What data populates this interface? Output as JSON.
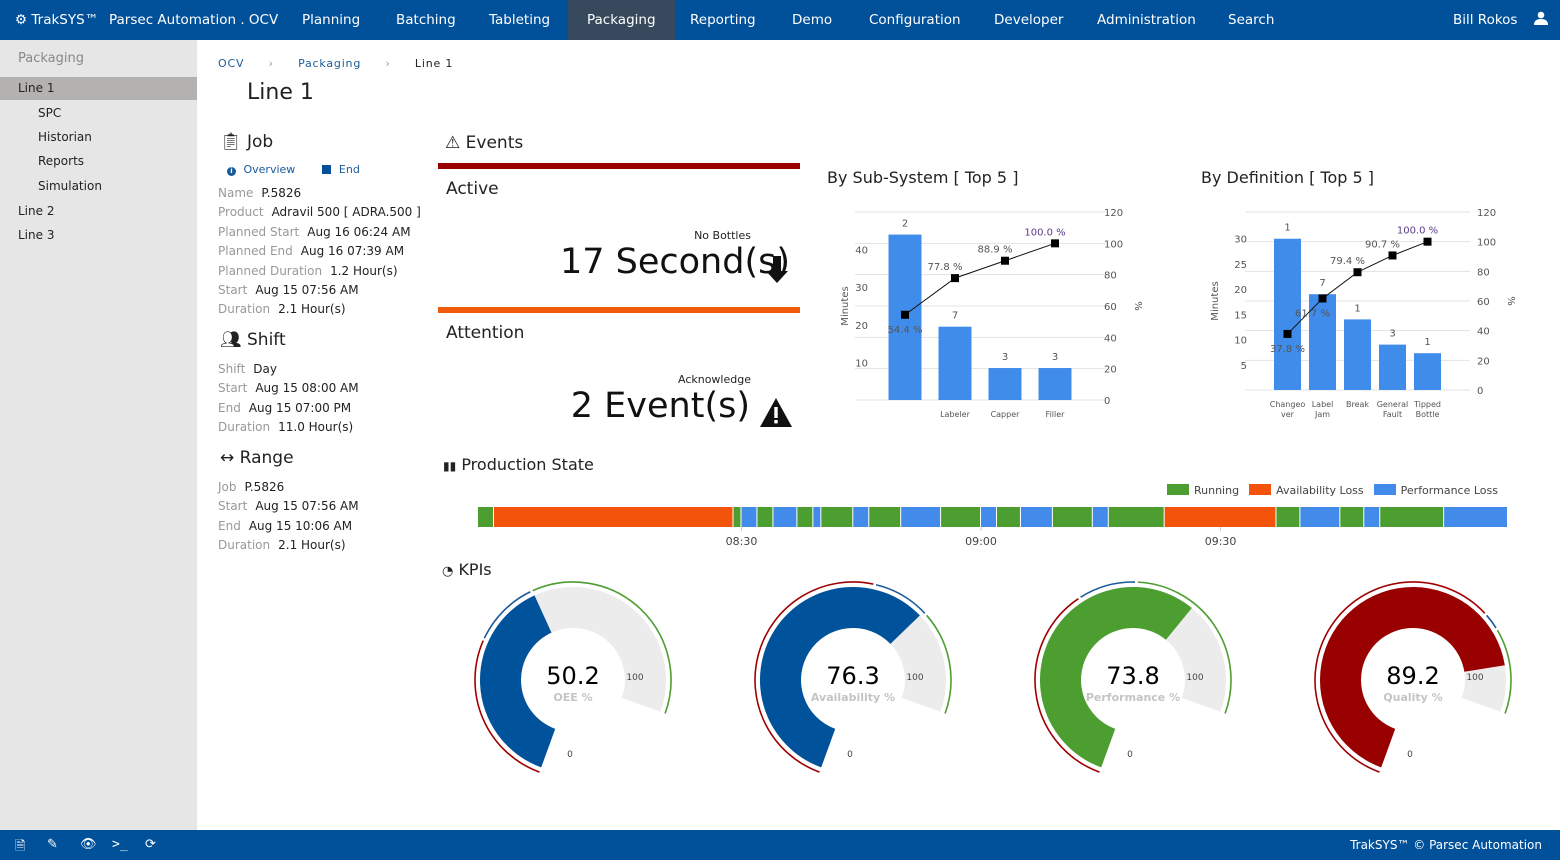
{
  "nav": {
    "brand": "TrakSYS™",
    "site": "Parsec Automation . OCV",
    "items": [
      "Planning",
      "Batching",
      "Tableting",
      "Packaging",
      "Reporting",
      "Demo",
      "Configuration",
      "Developer",
      "Administration",
      "Search"
    ],
    "active": "Packaging",
    "user": "Bill Rokos"
  },
  "sidebar": {
    "header": "Packaging",
    "items": [
      {
        "label": "Line 1",
        "selected": true
      },
      {
        "label": "SPC"
      },
      {
        "label": "Historian"
      },
      {
        "label": "Reports"
      },
      {
        "label": "Simulation"
      },
      {
        "label": "Line 2"
      },
      {
        "label": "Line 3"
      }
    ]
  },
  "breadcrumb": [
    "OCV",
    "Packaging",
    "Line 1"
  ],
  "page_title": "Line 1",
  "job": {
    "title": "Job",
    "overview": "Overview",
    "end": "End",
    "fields": [
      [
        "Name",
        "P.5826"
      ],
      [
        "Product",
        "Adravil 500 [ ADRA.500 ]"
      ],
      [
        "Planned Start",
        "Aug 16 06:24 AM"
      ],
      [
        "Planned End",
        "Aug 16 07:39 AM"
      ],
      [
        "Planned Duration",
        "1.2 Hour(s)"
      ],
      [
        "Start",
        "Aug 15 07:56 AM"
      ],
      [
        "Duration",
        "2.1 Hour(s)"
      ]
    ]
  },
  "shift": {
    "title": "Shift",
    "fields": [
      [
        "Shift",
        "Day"
      ],
      [
        "Start",
        "Aug 15 08:00 AM"
      ],
      [
        "End",
        "Aug 15 07:00 PM"
      ],
      [
        "Duration",
        "11.0 Hour(s)"
      ]
    ]
  },
  "range": {
    "title": "Range",
    "fields": [
      [
        "Job",
        "P.5826"
      ],
      [
        "Start",
        "Aug 15 07:56 AM"
      ],
      [
        "End",
        "Aug 15 10:06 AM"
      ],
      [
        "Duration",
        "2.1 Hour(s)"
      ]
    ]
  },
  "events": {
    "title": "Events",
    "active": {
      "label": "Active",
      "caption": "No Bottles",
      "value": "17 Second(s)",
      "color": "#9b0000"
    },
    "attention": {
      "label": "Attention",
      "caption": "Acknowledge",
      "value": "2 Event(s)",
      "color": "#f05a0a"
    }
  },
  "chart_data": [
    {
      "type": "bar",
      "title": "By Sub-System [ Top 5 ]",
      "ylabel": "Minutes",
      "y2label": "%",
      "yticks": [
        10,
        20,
        30,
        40
      ],
      "y2ticks": [
        0,
        20,
        40,
        60,
        80,
        100,
        120
      ],
      "ylim": [
        0,
        50
      ],
      "y2lim": [
        0,
        120
      ],
      "categories": [
        "",
        "Labeler",
        "Capper",
        "Filler"
      ],
      "values": [
        44,
        19.5,
        8.5,
        8.5
      ],
      "bar_labels": [
        "2",
        "7",
        "3",
        "3"
      ],
      "cumulative": [
        54.4,
        77.8,
        88.9,
        100.0
      ],
      "cumulative_labels": [
        "54.4 %",
        "77.8 %",
        "88.9 %",
        "100.0 %"
      ],
      "color": "#3f8ceb"
    },
    {
      "type": "bar",
      "title": "By Definition [ Top 5 ]",
      "ylabel": "Minutes",
      "y2label": "%",
      "yticks": [
        5,
        10,
        15,
        20,
        25,
        30
      ],
      "y2ticks": [
        0,
        20,
        40,
        60,
        80,
        100,
        120
      ],
      "ylim": [
        0,
        35.3
      ],
      "y2lim": [
        0,
        120
      ],
      "categories": [
        [
          "Changeo",
          "ver"
        ],
        [
          "Label",
          "Jam"
        ],
        [
          "Break"
        ],
        [
          "General",
          "Fault"
        ],
        [
          "Tipped",
          "Bottle"
        ]
      ],
      "values": [
        30,
        19,
        14,
        9,
        7.3
      ],
      "bar_labels": [
        "1",
        "7",
        "1",
        "3",
        "1"
      ],
      "cumulative": [
        37.8,
        61.7,
        79.4,
        90.7,
        100.0
      ],
      "cumulative_labels": [
        "37.8 %",
        "61.7 %",
        "79.4 %",
        "90.7 %",
        "100.0 %"
      ],
      "color": "#3f8ceb"
    }
  ],
  "production": {
    "title": "Production State",
    "legend": [
      {
        "name": "Running",
        "color": "#4c9e30"
      },
      {
        "name": "Availability Loss",
        "color": "#f3530a"
      },
      {
        "name": "Performance Loss",
        "color": "#428bea"
      }
    ],
    "start": "07:57",
    "end": "10:06",
    "ticks": [
      "08:30",
      "09:00",
      "09:30"
    ],
    "segments": [
      [
        "07:57",
        "Running"
      ],
      [
        "07:59",
        "Availability Loss"
      ],
      [
        "08:29",
        "Running"
      ],
      [
        "08:30",
        "Performance Loss"
      ],
      [
        "08:32",
        "Running"
      ],
      [
        "08:34",
        "Performance Loss"
      ],
      [
        "08:37",
        "Running"
      ],
      [
        "08:39",
        "Performance Loss"
      ],
      [
        "08:40",
        "Running"
      ],
      [
        "08:44",
        "Performance Loss"
      ],
      [
        "08:46",
        "Running"
      ],
      [
        "08:50",
        "Performance Loss"
      ],
      [
        "08:55",
        "Running"
      ],
      [
        "09:00",
        "Performance Loss"
      ],
      [
        "09:02",
        "Running"
      ],
      [
        "09:05",
        "Performance Loss"
      ],
      [
        "09:09",
        "Running"
      ],
      [
        "09:14",
        "Performance Loss"
      ],
      [
        "09:16",
        "Running"
      ],
      [
        "09:23",
        "Availability Loss"
      ],
      [
        "09:37",
        "Running"
      ],
      [
        "09:40",
        "Performance Loss"
      ],
      [
        "09:45",
        "Running"
      ],
      [
        "09:48",
        "Performance Loss"
      ],
      [
        "09:50",
        "Running"
      ],
      [
        "09:58",
        "Performance Loss"
      ]
    ]
  },
  "kpis": {
    "title": "KPIs",
    "min": "0",
    "max": "100",
    "gauges": [
      {
        "value": 50.2,
        "text": "50.2",
        "label": "OEE %",
        "color": "#00529b",
        "bands": [
          35,
          50
        ]
      },
      {
        "value": 76.3,
        "text": "76.3",
        "label": "Availability %",
        "color": "#00529b",
        "bands": [
          64,
          77
        ]
      },
      {
        "value": 73.8,
        "text": "73.8",
        "label": "Performance %",
        "color": "#4c9e30",
        "bands": [
          47,
          60
        ]
      },
      {
        "value": 89.2,
        "text": "89.2",
        "label": "Quality %",
        "color": "#990000",
        "bands": [
          77,
          81
        ]
      }
    ],
    "band_colors": [
      "#a00000",
      "#1a5a9a",
      "#4c9e30"
    ],
    "track_color": "#ececec"
  },
  "footer": {
    "icons": [
      "document-icon",
      "edit-icon",
      "eye-icon",
      "terminal-icon",
      "refresh-icon"
    ],
    "copyright": "TrakSYS™ © Parsec Automation"
  }
}
